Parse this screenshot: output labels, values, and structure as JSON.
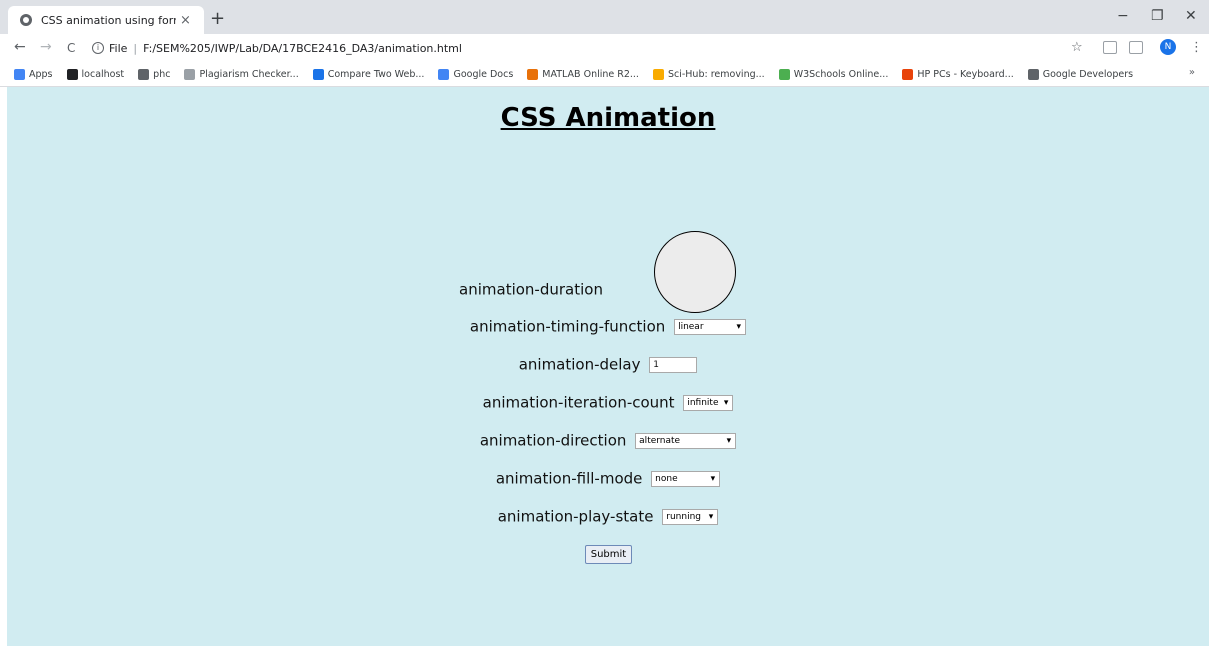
{
  "browser": {
    "tab_title": "CSS animation using forms",
    "tab_close": "×",
    "new_tab": "+",
    "window_controls": {
      "minimize": "−",
      "maximize": "❐",
      "close": "✕"
    },
    "nav": {
      "back": "←",
      "forward": "→",
      "reload": "C"
    },
    "address_prefix": "File",
    "address": "F:/SEM%205/IWP/Lab/DA/17BCE2416_DA3/animation.html",
    "avatar_letter": "N",
    "bookmarks": [
      {
        "label": "Apps",
        "color": "#4285f4"
      },
      {
        "label": "localhost",
        "color": "#202124"
      },
      {
        "label": "phc",
        "color": "#5f6368"
      },
      {
        "label": "Plagiarism Checker...",
        "color": "#9aa0a6"
      },
      {
        "label": "Compare Two Web...",
        "color": "#1a73e8"
      },
      {
        "label": "Google Docs",
        "color": "#4285f4"
      },
      {
        "label": "MATLAB Online R2...",
        "color": "#e8710a"
      },
      {
        "label": "Sci-Hub: removing...",
        "color": "#f9ab00"
      },
      {
        "label": "W3Schools Online...",
        "color": "#4caf50"
      },
      {
        "label": "HP PCs - Keyboard...",
        "color": "#e8430a"
      },
      {
        "label": "Google Developers",
        "color": "#5f6368"
      }
    ],
    "bookmarks_more": "»"
  },
  "page": {
    "title": "CSS Animation",
    "background_color": "#d1ecf1",
    "form": {
      "duration": {
        "label": "animation-duration"
      },
      "timing_function": {
        "label": "animation-timing-function",
        "value": "linear"
      },
      "delay": {
        "label": "animation-delay",
        "value": "1"
      },
      "iteration_count": {
        "label": "animation-iteration-count",
        "value": "infinite"
      },
      "direction": {
        "label": "animation-direction",
        "value": "alternate"
      },
      "fill_mode": {
        "label": "animation-fill-mode",
        "value": "none"
      },
      "play_state": {
        "label": "animation-play-state",
        "value": "running"
      },
      "submit_label": "Submit"
    }
  }
}
